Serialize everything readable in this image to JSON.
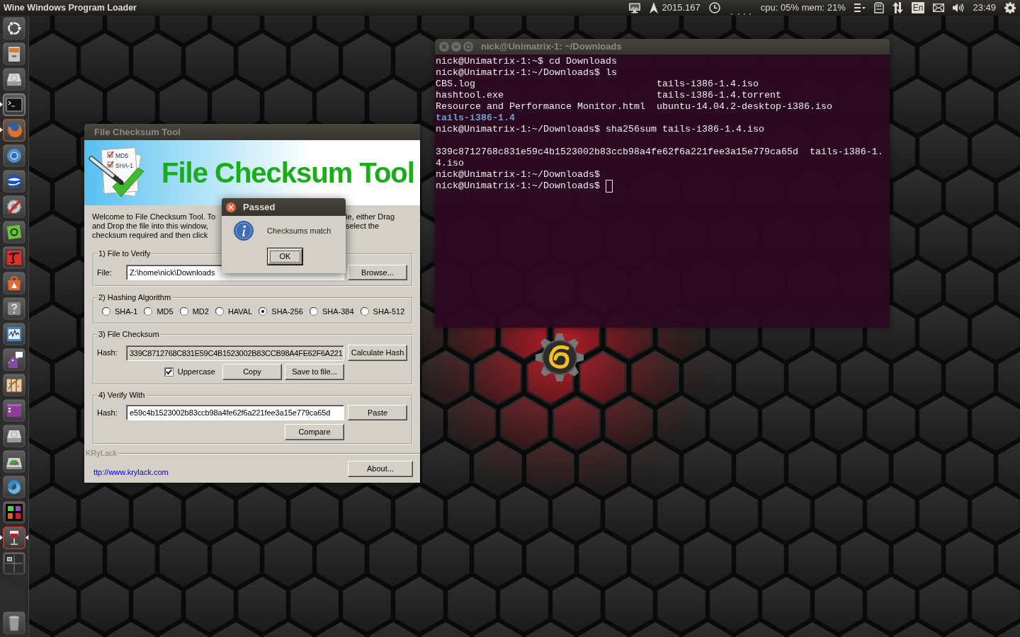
{
  "top_panel": {
    "app_title": "Wine Windows Program Loader",
    "indicators": [
      {
        "kind": "display"
      },
      {
        "kind": "stardate",
        "text": "2015.167"
      },
      {
        "kind": "clock"
      },
      {
        "kind": "graph"
      },
      {
        "kind": "system_load",
        "text": "cpu: 05% mem: 21%"
      },
      {
        "kind": "menu"
      },
      {
        "kind": "card"
      },
      {
        "kind": "network"
      },
      {
        "kind": "keyboard",
        "text": "En"
      },
      {
        "kind": "mail"
      },
      {
        "kind": "sound"
      },
      {
        "kind": "time",
        "text": "23:49"
      },
      {
        "kind": "session"
      }
    ]
  },
  "launcher": [
    {
      "kind": "dash",
      "running": false,
      "focused": false
    },
    {
      "kind": "files",
      "running": false,
      "focused": false
    },
    {
      "kind": "drive",
      "running": false,
      "focused": false
    },
    {
      "kind": "terminal",
      "running": true,
      "focused": false
    },
    {
      "kind": "browser",
      "running": true,
      "focused": false
    },
    {
      "kind": "ring_browser",
      "running": false,
      "focused": false
    },
    {
      "kind": "globe",
      "running": false,
      "focused": false
    },
    {
      "kind": "settings",
      "running": false,
      "focused": false
    },
    {
      "kind": "green_tile",
      "running": false,
      "focused": false
    },
    {
      "kind": "script_tile",
      "running": false,
      "focused": false
    },
    {
      "kind": "bag",
      "running": false,
      "focused": false
    },
    {
      "kind": "help",
      "running": false,
      "focused": false
    },
    {
      "kind": "graph",
      "running": false,
      "focused": false
    },
    {
      "kind": "chat",
      "running": false,
      "focused": false
    },
    {
      "kind": "screen",
      "running": false,
      "focused": false
    },
    {
      "kind": "window",
      "running": false,
      "focused": false
    },
    {
      "kind": "drive",
      "running": false,
      "focused": false
    },
    {
      "kind": "gauge",
      "running": false,
      "focused": false
    },
    {
      "kind": "swirl",
      "running": false,
      "focused": false
    },
    {
      "kind": "game",
      "running": false,
      "focused": false
    },
    {
      "kind": "wine_glass",
      "running": true,
      "focused": true
    },
    {
      "kind": "workspaces",
      "running": false,
      "focused": false
    },
    {
      "kind": "trash",
      "running": false,
      "focused": false
    }
  ],
  "terminal": {
    "title": "nick@Unimatrix-1: ~/Downloads",
    "focused": false,
    "cursor": true,
    "lines": [
      {
        "kind": "text",
        "text": "nick@Unimatrix-1:~$ cd Downloads"
      },
      {
        "kind": "text",
        "text": "nick@Unimatrix-1:~/Downloads$ ls"
      },
      {
        "kind": "listing",
        "entries": [
          {
            "name": "CBS.log",
            "directory": false
          },
          {
            "name": "hashtool.exe",
            "directory": false
          },
          {
            "name": "Resource and Performance Monitor.html",
            "directory": false
          },
          {
            "name": "tails-i386-1.4",
            "directory": true
          },
          {
            "name": "tails-i386-1.4.iso",
            "directory": false
          },
          {
            "name": "tails-i386-1.4.torrent",
            "directory": false
          },
          {
            "name": "ubuntu-14.04.2-desktop-i386.iso",
            "directory": false
          }
        ]
      },
      {
        "kind": "text",
        "text": "nick@Unimatrix-1:~/Downloads$ sha256sum tails-i386-1.4.iso"
      },
      {
        "kind": "blank"
      },
      {
        "kind": "text",
        "text": "339c8712768c831e59c4b1523002b83ccb98a4fe62f6a221fee3a15e779ca65d  tails-i386-1.4.iso"
      },
      {
        "kind": "text",
        "text": "nick@Unimatrix-1:~/Downloads$"
      },
      {
        "kind": "text",
        "text": "nick@Unimatrix-1:~/Downloads$"
      }
    ]
  },
  "checksum_window": {
    "title": "File Checksum Tool",
    "focused": false,
    "banner": {
      "logo_labels": [
        "MD5",
        "SHA-1"
      ],
      "heading": "File Checksum Tool"
    },
    "welcome_left": [
      "Welcome to File Checksum Tool. To",
      "and Drop the file into this window,",
      "checksum required and then click"
    ],
    "welcome_right": [
      "le, either Drag",
      "select the"
    ],
    "file_group": {
      "legend": "1) File to Verify",
      "label": "File:",
      "value": "Z:\\home\\nick\\Downloads",
      "button": "Browse..."
    },
    "algorithm_group": {
      "legend": "2) Hashing Algorithm",
      "options": [
        {
          "label": "SHA-1",
          "selected": false
        },
        {
          "label": "MD5",
          "selected": false
        },
        {
          "label": "MD2",
          "selected": false
        },
        {
          "label": "HAVAL",
          "selected": false
        },
        {
          "label": "SHA-256",
          "selected": true
        },
        {
          "label": "SHA-384",
          "selected": false
        },
        {
          "label": "SHA-512",
          "selected": false
        }
      ]
    },
    "checksum_group": {
      "legend": "3) File Checksum",
      "label": "Hash:",
      "value": "339C8712768C831E59C4B1523002B83CCB98A4FE62F6A221",
      "calculate_button": "Calculate Hash",
      "uppercase": {
        "label": "Uppercase",
        "checked": true
      },
      "copy_button": "Copy",
      "save_button": "Save to file..."
    },
    "verify_group": {
      "legend": "4) Verify With",
      "label": "Hash:",
      "value": "e59c4b1523002b83ccb98a4fe62f6a221fee3a15e779ca65d",
      "paste_button": "Paste",
      "compare_button": "Compare"
    },
    "footer": {
      "brand": "KRyLack",
      "link": "ttp://www.krylack.com",
      "about_button": "About..."
    }
  },
  "dialog": {
    "title": "Passed",
    "focused": true,
    "message": "Checksums match",
    "ok_button": {
      "label": "OK",
      "default": true
    }
  }
}
